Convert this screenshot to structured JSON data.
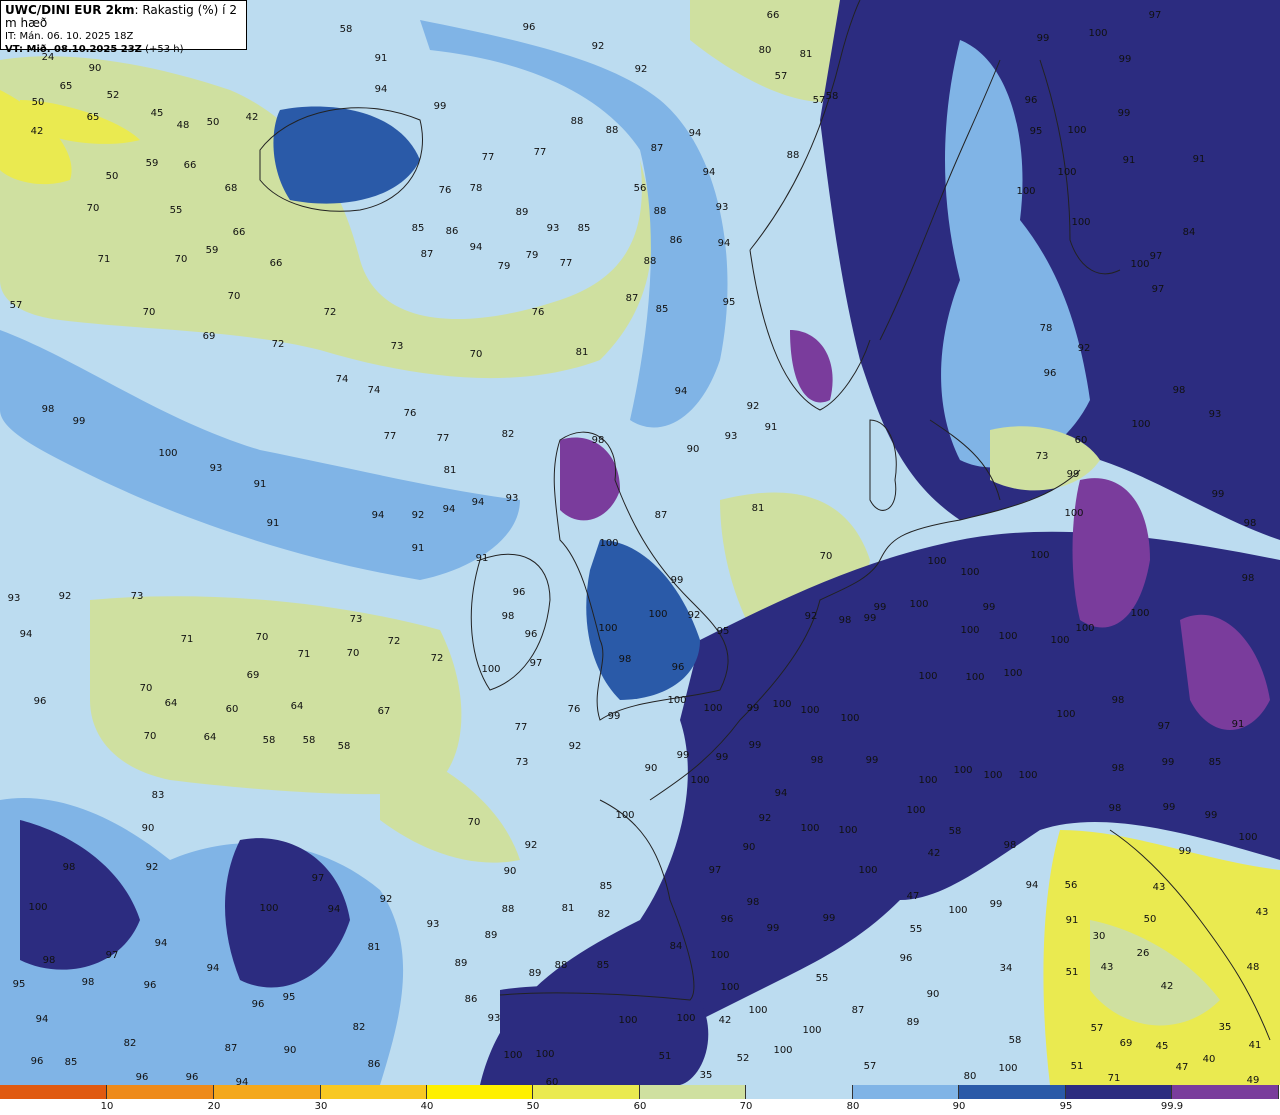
{
  "header": {
    "model": "UWC/DINI EUR 2km",
    "parameter": ": Rakastig (%) í 2 m hæð",
    "issued": "IT: Mán. 06. 10. 2025 18Z",
    "valid": "VT: Mið. 08.10.2025 23Z",
    "lead": " (+53 h)"
  },
  "colors": {
    "c0": "#e05a10",
    "c10": "#ee8a1a",
    "c20": "#f4a81c",
    "c30": "#f8c822",
    "c40": "#fff000",
    "c50": "#eaea50",
    "c60": "#cfe0a0",
    "c70": "#bcdcf0",
    "c80": "#80b4e6",
    "c90": "#2a5aa8",
    "c95": "#2c2c80",
    "c99": "#7a3c9c",
    "land_line": "#222222"
  },
  "legend": {
    "segments": [
      {
        "w": 107,
        "color": "#e05a10"
      },
      {
        "w": 107,
        "color": "#ee8a1a"
      },
      {
        "w": 107,
        "color": "#f4a81c"
      },
      {
        "w": 106,
        "color": "#f8c822"
      },
      {
        "w": 106,
        "color": "#fff000"
      },
      {
        "w": 107,
        "color": "#eaea50"
      },
      {
        "w": 106,
        "color": "#cfe0a0"
      },
      {
        "w": 107,
        "color": "#bcdcf0"
      },
      {
        "w": 106,
        "color": "#80b4e6"
      },
      {
        "w": 107,
        "color": "#2a5aa8"
      },
      {
        "w": 106,
        "color": "#2c2c80"
      },
      {
        "w": 107,
        "color": "#7a3c9c"
      }
    ],
    "ticks": [
      "10",
      "20",
      "30",
      "40",
      "50",
      "60",
      "70",
      "80",
      "90",
      "95",
      "99.9"
    ]
  },
  "labels": [
    [
      "58",
      346,
      29
    ],
    [
      "96",
      529,
      27
    ],
    [
      "92",
      598,
      46
    ],
    [
      "66",
      773,
      15
    ],
    [
      "97",
      1155,
      15
    ],
    [
      "99",
      1043,
      38
    ],
    [
      "100",
      1098,
      33
    ],
    [
      "80",
      765,
      50
    ],
    [
      "81",
      806,
      54
    ],
    [
      "57",
      781,
      76
    ],
    [
      "92",
      641,
      69
    ],
    [
      "57",
      819,
      100
    ],
    [
      "58",
      832,
      96
    ],
    [
      "91",
      381,
      58
    ],
    [
      "94",
      381,
      89
    ],
    [
      "99",
      440,
      106
    ],
    [
      "24",
      48,
      57
    ],
    [
      "90",
      95,
      68
    ],
    [
      "65",
      66,
      86
    ],
    [
      "52",
      113,
      95
    ],
    [
      "50",
      38,
      102
    ],
    [
      "45",
      157,
      113
    ],
    [
      "42",
      252,
      117
    ],
    [
      "48",
      183,
      125
    ],
    [
      "50",
      213,
      122
    ],
    [
      "42",
      37,
      131
    ],
    [
      "65",
      93,
      117
    ],
    [
      "88",
      577,
      121
    ],
    [
      "88",
      612,
      130
    ],
    [
      "94",
      695,
      133
    ],
    [
      "87",
      657,
      148
    ],
    [
      "77",
      488,
      157
    ],
    [
      "77",
      540,
      152
    ],
    [
      "59",
      152,
      163
    ],
    [
      "66",
      190,
      165
    ],
    [
      "50",
      112,
      176
    ],
    [
      "68",
      231,
      188
    ],
    [
      "76",
      445,
      190
    ],
    [
      "78",
      476,
      188
    ],
    [
      "56",
      640,
      188
    ],
    [
      "88",
      793,
      155
    ],
    [
      "94",
      709,
      172
    ],
    [
      "99",
      1125,
      59
    ],
    [
      "99",
      1124,
      113
    ],
    [
      "100",
      1077,
      130
    ],
    [
      "100",
      1067,
      172
    ],
    [
      "100",
      1081,
      222
    ],
    [
      "91",
      1129,
      160
    ],
    [
      "96",
      1031,
      100
    ],
    [
      "95",
      1036,
      131
    ],
    [
      "100",
      1026,
      191
    ],
    [
      "100",
      1140,
      264
    ],
    [
      "97",
      1156,
      256
    ],
    [
      "97",
      1158,
      289
    ],
    [
      "84",
      1189,
      232
    ],
    [
      "91",
      1199,
      159
    ],
    [
      "55",
      176,
      210
    ],
    [
      "70",
      93,
      208
    ],
    [
      "89",
      522,
      212
    ],
    [
      "93",
      553,
      228
    ],
    [
      "85",
      584,
      228
    ],
    [
      "85",
      418,
      228
    ],
    [
      "86",
      452,
      231
    ],
    [
      "88",
      660,
      211
    ],
    [
      "93",
      722,
      207
    ],
    [
      "70",
      181,
      259
    ],
    [
      "71",
      104,
      259
    ],
    [
      "66",
      239,
      232
    ],
    [
      "66",
      276,
      263
    ],
    [
      "59",
      212,
      250
    ],
    [
      "87",
      427,
      254
    ],
    [
      "94",
      476,
      247
    ],
    [
      "79",
      504,
      266
    ],
    [
      "79",
      532,
      255
    ],
    [
      "77",
      566,
      263
    ],
    [
      "86",
      676,
      240
    ],
    [
      "94",
      724,
      243
    ],
    [
      "88",
      650,
      261
    ],
    [
      "57",
      16,
      305
    ],
    [
      "70",
      234,
      296
    ],
    [
      "70",
      149,
      312
    ],
    [
      "72",
      330,
      312
    ],
    [
      "76",
      538,
      312
    ],
    [
      "87",
      632,
      298
    ],
    [
      "85",
      662,
      309
    ],
    [
      "95",
      729,
      302
    ],
    [
      "69",
      209,
      336
    ],
    [
      "72",
      278,
      344
    ],
    [
      "73",
      397,
      346
    ],
    [
      "70",
      476,
      354
    ],
    [
      "81",
      582,
      352
    ],
    [
      "74",
      342,
      379
    ],
    [
      "74",
      374,
      390
    ],
    [
      "76",
      410,
      413
    ],
    [
      "94",
      681,
      391
    ],
    [
      "92",
      753,
      406
    ],
    [
      "98",
      48,
      409
    ],
    [
      "99",
      79,
      421
    ],
    [
      "77",
      390,
      436
    ],
    [
      "77",
      443,
      438
    ],
    [
      "82",
      508,
      434
    ],
    [
      "93",
      731,
      436
    ],
    [
      "91",
      771,
      427
    ],
    [
      "90",
      693,
      449
    ],
    [
      "100",
      168,
      453
    ],
    [
      "93",
      216,
      468
    ],
    [
      "81",
      450,
      470
    ],
    [
      "98",
      598,
      440
    ],
    [
      "91",
      260,
      484
    ],
    [
      "94",
      378,
      515
    ],
    [
      "92",
      418,
      515
    ],
    [
      "94",
      449,
      509
    ],
    [
      "94",
      478,
      502
    ],
    [
      "93",
      512,
      498
    ],
    [
      "81",
      758,
      508
    ],
    [
      "87",
      661,
      515
    ],
    [
      "91",
      273,
      523
    ],
    [
      "91",
      418,
      548
    ],
    [
      "100",
      609,
      543
    ],
    [
      "70",
      826,
      556
    ],
    [
      "73",
      1042,
      456
    ],
    [
      "60",
      1081,
      440
    ],
    [
      "99",
      1073,
      474
    ],
    [
      "100",
      1074,
      513
    ],
    [
      "78",
      1046,
      328
    ],
    [
      "92",
      1084,
      348
    ],
    [
      "96",
      1050,
      373
    ],
    [
      "98",
      1179,
      390
    ],
    [
      "93",
      1215,
      414
    ],
    [
      "100",
      1141,
      424
    ],
    [
      "99",
      1218,
      494
    ],
    [
      "98",
      1250,
      523
    ],
    [
      "100",
      970,
      572
    ],
    [
      "100",
      937,
      561
    ],
    [
      "100",
      1040,
      555
    ],
    [
      "99",
      880,
      607
    ],
    [
      "100",
      919,
      604
    ],
    [
      "99",
      989,
      607
    ],
    [
      "100",
      970,
      630
    ],
    [
      "100",
      1008,
      636
    ],
    [
      "100",
      1060,
      640
    ],
    [
      "100",
      1085,
      628
    ],
    [
      "98",
      1248,
      578
    ],
    [
      "100",
      1140,
      613
    ],
    [
      "93",
      14,
      598
    ],
    [
      "92",
      65,
      596
    ],
    [
      "73",
      137,
      596
    ],
    [
      "73",
      356,
      619
    ],
    [
      "94",
      26,
      634
    ],
    [
      "71",
      187,
      639
    ],
    [
      "70",
      262,
      637
    ],
    [
      "71",
      304,
      654
    ],
    [
      "70",
      353,
      653
    ],
    [
      "72",
      394,
      641
    ],
    [
      "72",
      437,
      658
    ],
    [
      "98",
      845,
      620
    ],
    [
      "99",
      870,
      618
    ],
    [
      "92",
      811,
      616
    ],
    [
      "91",
      482,
      558
    ],
    [
      "96",
      519,
      592
    ],
    [
      "98",
      508,
      616
    ],
    [
      "96",
      531,
      634
    ],
    [
      "97",
      536,
      663
    ],
    [
      "100",
      491,
      669
    ],
    [
      "76",
      574,
      709
    ],
    [
      "100",
      608,
      628
    ],
    [
      "98",
      625,
      659
    ],
    [
      "100",
      658,
      614
    ],
    [
      "99",
      677,
      580
    ],
    [
      "92",
      694,
      615
    ],
    [
      "95",
      723,
      631
    ],
    [
      "96",
      678,
      667
    ],
    [
      "96",
      40,
      701
    ],
    [
      "70",
      146,
      688
    ],
    [
      "64",
      171,
      703
    ],
    [
      "60",
      232,
      709
    ],
    [
      "69",
      253,
      675
    ],
    [
      "64",
      297,
      706
    ],
    [
      "67",
      384,
      711
    ],
    [
      "100",
      677,
      700
    ],
    [
      "100",
      713,
      708
    ],
    [
      "99",
      614,
      716
    ],
    [
      "99",
      753,
      708
    ],
    [
      "100",
      782,
      704
    ],
    [
      "100",
      810,
      710
    ],
    [
      "100",
      850,
      718
    ],
    [
      "100",
      928,
      676
    ],
    [
      "100",
      975,
      677
    ],
    [
      "100",
      1013,
      673
    ],
    [
      "100",
      1066,
      714
    ],
    [
      "98",
      1118,
      700
    ],
    [
      "91",
      1238,
      724
    ],
    [
      "70",
      150,
      736
    ],
    [
      "64",
      210,
      737
    ],
    [
      "58",
      269,
      740
    ],
    [
      "58",
      309,
      740
    ],
    [
      "58",
      344,
      746
    ],
    [
      "77",
      521,
      727
    ],
    [
      "92",
      575,
      746
    ],
    [
      "73",
      522,
      762
    ],
    [
      "99",
      755,
      745
    ],
    [
      "99",
      683,
      755
    ],
    [
      "90",
      651,
      768
    ],
    [
      "100",
      700,
      780
    ],
    [
      "99",
      722,
      757
    ],
    [
      "98",
      817,
      760
    ],
    [
      "99",
      872,
      760
    ],
    [
      "100",
      928,
      780
    ],
    [
      "100",
      963,
      770
    ],
    [
      "100",
      993,
      775
    ],
    [
      "100",
      1028,
      775
    ],
    [
      "98",
      1118,
      768
    ],
    [
      "99",
      1168,
      762
    ],
    [
      "97",
      1164,
      726
    ],
    [
      "85",
      1215,
      762
    ],
    [
      "83",
      158,
      795
    ],
    [
      "70",
      474,
      822
    ],
    [
      "94",
      781,
      793
    ],
    [
      "92",
      765,
      818
    ],
    [
      "100",
      810,
      828
    ],
    [
      "100",
      848,
      830
    ],
    [
      "100",
      916,
      810
    ],
    [
      "100",
      625,
      815
    ],
    [
      "58",
      955,
      831
    ],
    [
      "42",
      934,
      853
    ],
    [
      "98",
      1010,
      845
    ],
    [
      "90",
      749,
      847
    ],
    [
      "100",
      868,
      870
    ],
    [
      "98",
      1115,
      808
    ],
    [
      "99",
      1169,
      807
    ],
    [
      "99",
      1211,
      815
    ],
    [
      "100",
      1248,
      837
    ],
    [
      "99",
      1185,
      851
    ],
    [
      "90",
      148,
      828
    ],
    [
      "92",
      152,
      867
    ],
    [
      "98",
      69,
      867
    ],
    [
      "97",
      318,
      878
    ],
    [
      "92",
      386,
      899
    ],
    [
      "100",
      269,
      908
    ],
    [
      "100",
      38,
      907
    ],
    [
      "94",
      334,
      909
    ],
    [
      "93",
      433,
      924
    ],
    [
      "97",
      715,
      870
    ],
    [
      "85",
      606,
      886
    ],
    [
      "88",
      508,
      909
    ],
    [
      "81",
      568,
      908
    ],
    [
      "82",
      604,
      914
    ],
    [
      "90",
      510,
      871
    ],
    [
      "92",
      531,
      845
    ],
    [
      "47",
      913,
      896
    ],
    [
      "98",
      753,
      902
    ],
    [
      "96",
      727,
      919
    ],
    [
      "99",
      773,
      928
    ],
    [
      "99",
      829,
      918
    ],
    [
      "99",
      996,
      904
    ],
    [
      "94",
      1032,
      885
    ],
    [
      "56",
      1071,
      885
    ],
    [
      "43",
      1159,
      887
    ],
    [
      "50",
      1150,
      919
    ],
    [
      "43",
      1262,
      912
    ],
    [
      "100",
      958,
      910
    ],
    [
      "55",
      916,
      929
    ],
    [
      "91",
      1072,
      920
    ],
    [
      "30",
      1099,
      936
    ],
    [
      "43",
      1107,
      967
    ],
    [
      "26",
      1143,
      953
    ],
    [
      "42",
      1167,
      986
    ],
    [
      "48",
      1253,
      967
    ],
    [
      "51",
      1072,
      972
    ],
    [
      "94",
      161,
      943
    ],
    [
      "97",
      112,
      955
    ],
    [
      "94",
      213,
      968
    ],
    [
      "81",
      374,
      947
    ],
    [
      "89",
      491,
      935
    ],
    [
      "89",
      461,
      963
    ],
    [
      "89",
      535,
      973
    ],
    [
      "88",
      561,
      965
    ],
    [
      "85",
      603,
      965
    ],
    [
      "84",
      676,
      946
    ],
    [
      "100",
      720,
      955
    ],
    [
      "96",
      906,
      958
    ],
    [
      "34",
      1006,
      968
    ],
    [
      "55",
      822,
      978
    ],
    [
      "98",
      49,
      960
    ],
    [
      "98",
      88,
      982
    ],
    [
      "96",
      150,
      985
    ],
    [
      "95",
      19,
      984
    ],
    [
      "100",
      730,
      987
    ],
    [
      "90",
      933,
      994
    ],
    [
      "94",
      42,
      1019
    ],
    [
      "96",
      258,
      1004
    ],
    [
      "95",
      289,
      997
    ],
    [
      "82",
      359,
      1027
    ],
    [
      "86",
      471,
      999
    ],
    [
      "93",
      494,
      1018
    ],
    [
      "100",
      628,
      1020
    ],
    [
      "100",
      686,
      1018
    ],
    [
      "100",
      758,
      1010
    ],
    [
      "100",
      812,
      1030
    ],
    [
      "87",
      858,
      1010
    ],
    [
      "89",
      913,
      1022
    ],
    [
      "42",
      725,
      1020
    ],
    [
      "58",
      1015,
      1040
    ],
    [
      "57",
      1097,
      1028
    ],
    [
      "35",
      1225,
      1027
    ],
    [
      "69",
      1126,
      1043
    ],
    [
      "45",
      1162,
      1046
    ],
    [
      "40",
      1209,
      1059
    ],
    [
      "47",
      1182,
      1067
    ],
    [
      "41",
      1255,
      1045
    ],
    [
      "82",
      130,
      1043
    ],
    [
      "87",
      231,
      1048
    ],
    [
      "90",
      290,
      1050
    ],
    [
      "96",
      37,
      1061
    ],
    [
      "85",
      71,
      1062
    ],
    [
      "86",
      374,
      1064
    ],
    [
      "100",
      513,
      1055
    ],
    [
      "100",
      545,
      1054
    ],
    [
      "51",
      665,
      1056
    ],
    [
      "52",
      743,
      1058
    ],
    [
      "100",
      783,
      1050
    ],
    [
      "57",
      870,
      1066
    ],
    [
      "51",
      1077,
      1066
    ],
    [
      "71",
      1114,
      1078
    ],
    [
      "96",
      192,
      1077
    ],
    [
      "96",
      142,
      1077
    ],
    [
      "94",
      242,
      1082
    ],
    [
      "35",
      706,
      1075
    ],
    [
      "60",
      552,
      1082
    ],
    [
      "80",
      970,
      1076
    ],
    [
      "100",
      1008,
      1068
    ],
    [
      "49",
      1253,
      1080
    ]
  ]
}
